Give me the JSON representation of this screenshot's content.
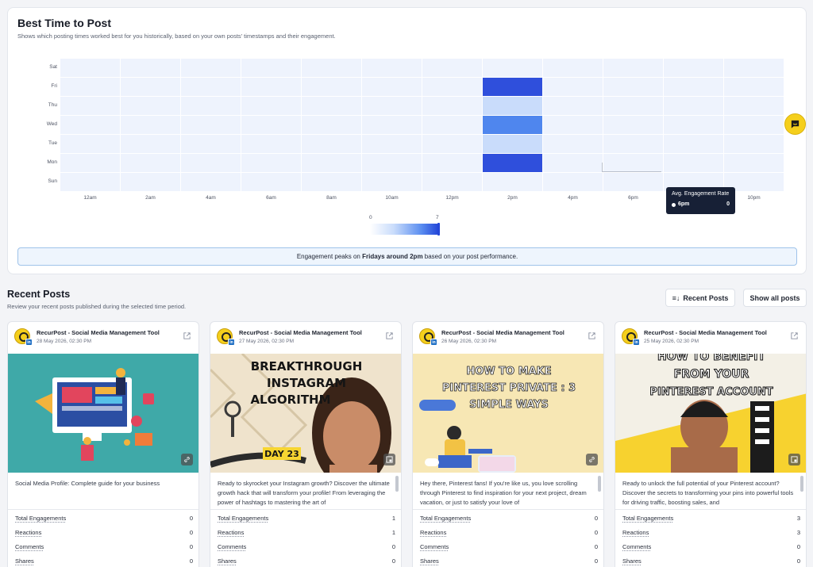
{
  "best_time": {
    "title": "Best Time to Post",
    "subtitle": "Shows which posting times worked best for you historically, based on your own posts' timestamps and their engagement.",
    "days": [
      "Sat",
      "Fri",
      "Thu",
      "Wed",
      "Tue",
      "Mon",
      "Sun"
    ],
    "hour_labels": [
      "12am",
      "2am",
      "4am",
      "6am",
      "8am",
      "10am",
      "12pm",
      "2pm",
      "4pm",
      "6pm",
      "8pm",
      "10pm"
    ],
    "cells": [
      {
        "day": "Fri",
        "slot": "2pm",
        "intensity": 1.0
      },
      {
        "day": "Thu",
        "slot": "2pm",
        "intensity": 0.25
      },
      {
        "day": "Wed",
        "slot": "2pm",
        "intensity": 0.7
      },
      {
        "day": "Tue",
        "slot": "2pm",
        "intensity": 0.25
      },
      {
        "day": "Mon",
        "slot": "2pm",
        "intensity": 1.0
      }
    ],
    "tooltip": {
      "title": "Avg. Engagement Rate",
      "label": "6pm",
      "value": "0"
    },
    "scale": {
      "min": "0",
      "max": "7"
    },
    "insight": {
      "prefix": "Engagement peaks on ",
      "highlight": "Fridays around 2pm",
      "suffix": " based on your post performance."
    },
    "colors": {
      "empty": "#eef3fd",
      "light": "#c9dcfb",
      "mid": "#4f86ee",
      "dark": "#2f4fdc"
    }
  },
  "recent_posts": {
    "title": "Recent Posts",
    "subtitle": "Review your recent posts published during the selected time period.",
    "sort_button": "Recent Posts",
    "show_all_button": "Show all posts",
    "stat_labels": [
      "Total Engagements",
      "Reactions",
      "Comments",
      "Shares"
    ],
    "posts": [
      {
        "account": "RecurPost - Social Media Management Tool",
        "date": "28 May 2026, 02:30 PM",
        "text": "Social Media Profile: Complete guide for your business",
        "poster": [],
        "stats": [
          "0",
          "0",
          "0",
          "0"
        ]
      },
      {
        "account": "RecurPost - Social Media Management Tool",
        "date": "27 May 2026, 02:30 PM",
        "text": "Ready to skyrocket your Instagram growth? Discover the ultimate growth hack that will transform your profile! From leveraging the power of hashtags to mastering the art of",
        "poster": [
          "BREAKTHROUGH",
          "INSTAGRAM",
          "ALGORITHM",
          "DAY 23"
        ],
        "stats": [
          "1",
          "1",
          "0",
          "0"
        ]
      },
      {
        "account": "RecurPost - Social Media Management Tool",
        "date": "26 May 2026, 02:30 PM",
        "text": "Hey there, Pinterest fans! If you're like us, you love scrolling through Pinterest to find inspiration for your next project, dream vacation, or just to satisfy your love of",
        "poster": [
          "HOW TO MAKE",
          "PINTEREST PRIVATE : 3",
          "SIMPLE WAYS"
        ],
        "stats": [
          "0",
          "0",
          "0",
          "0"
        ]
      },
      {
        "account": "RecurPost - Social Media Management Tool",
        "date": "25 May 2026, 02:30 PM",
        "text": "Ready to unlock the full potential of your Pinterest account? Discover the secrets to transforming your pins into powerful tools for driving traffic, boosting sales, and",
        "poster": [
          "HOW TO BENEFIT",
          "FROM YOUR",
          "PINTEREST ACCOUNT"
        ],
        "stats": [
          "3",
          "3",
          "0",
          "0"
        ]
      }
    ]
  }
}
